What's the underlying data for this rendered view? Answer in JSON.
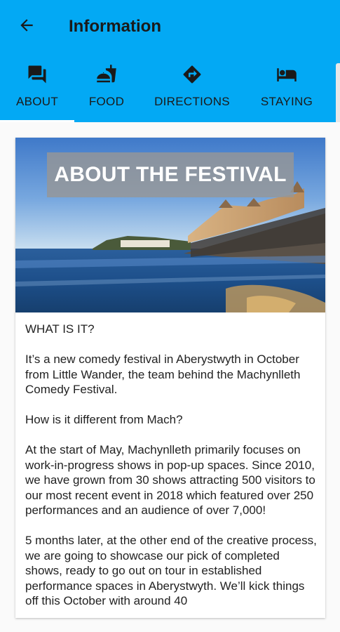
{
  "toolbar": {
    "title": "Information",
    "back_icon": "arrow-back-icon"
  },
  "tabs": [
    {
      "label": "ABOUT",
      "icon": "chat-icon",
      "selected": true
    },
    {
      "label": "FOOD",
      "icon": "restaurant-icon",
      "selected": false
    },
    {
      "label": "DIRECTIONS",
      "icon": "directions-icon",
      "selected": false
    },
    {
      "label": "STAYING",
      "icon": "hotel-bed-icon",
      "selected": false
    }
  ],
  "colors": {
    "appbar": "#03a9f4",
    "indicator": "#ffffff"
  },
  "card": {
    "hero_title": "ABOUT THE FESTIVAL",
    "paragraphs": [
      "WHAT IS IT?",
      "It’s a new comedy festival in Aberystwyth in October from Little Wander, the team behind the Machynlleth Comedy Festival.",
      "How is it different from Mach?",
      "At the start of May, Machynlleth primarily focuses on work-in-progress shows in pop-up spaces. Since 2010, we have grown from 30 shows attracting 500 visitors to our most recent event in 2018 which featured over 250 performances and an audience of over 7,000!",
      "5 months later, at the other end of the creative process, we are going to showcase our pick of completed shows, ready to go out on tour in established performance spaces in Aberystwyth. We’ll kick things off this October with around 40"
    ]
  }
}
